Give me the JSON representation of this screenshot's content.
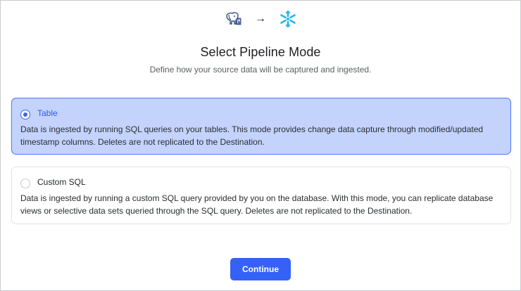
{
  "header": {
    "source_icon": "postgresql-elephant-icon",
    "arrow_icon": "arrow-right-icon",
    "destination_icon": "snowflake-icon",
    "title": "Select Pipeline Mode",
    "subtitle": "Define how your source data will be captured and ingested."
  },
  "options": [
    {
      "label": "Table",
      "selected": true,
      "description": "Data is ingested by running SQL queries on your tables. This mode provides change data capture through modified/updated timestamp columns. Deletes are not replicated to the Destination."
    },
    {
      "label": "Custom SQL",
      "selected": false,
      "description": "Data is ingested by running a custom SQL query provided by you on the database. With this mode, you can replicate database views or selective data sets queried through the SQL query. Deletes are not replicated to the Destination."
    }
  ],
  "footer": {
    "continue_label": "Continue"
  },
  "colors": {
    "accent": "#3462f6",
    "selected_bg": "#c3d3fc",
    "selected_border": "#4d78f0",
    "snowflake": "#29b5e8"
  }
}
